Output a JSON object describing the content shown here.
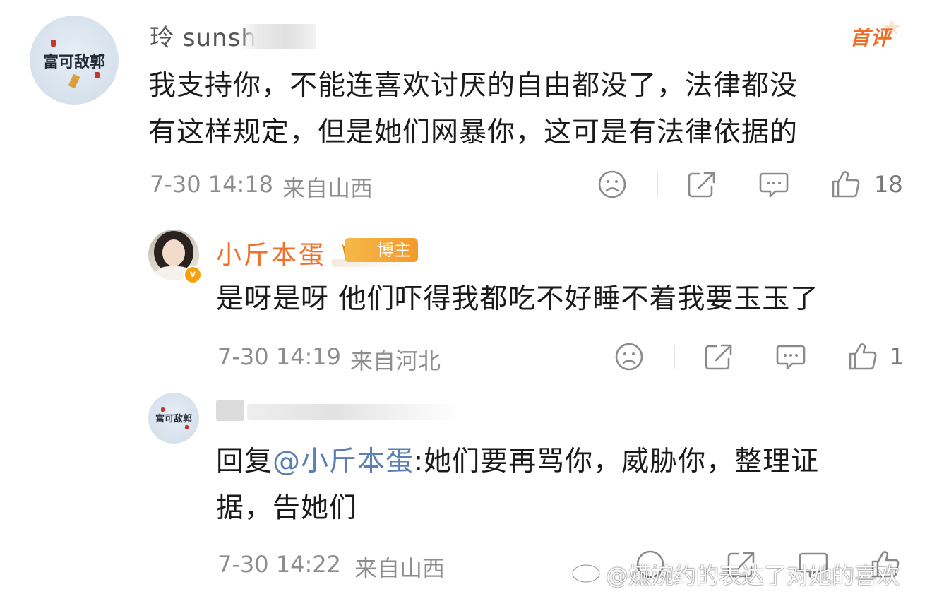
{
  "comments": [
    {
      "username": "玲 sunshine",
      "avatar_text": "富可敌郭",
      "badge": "首评",
      "text_lines": [
        "我支持你，不能连喜欢讨厌的自由都没了，法律都没",
        "有这样规定，但是她们网暴你，这可是有法律依据的"
      ],
      "time": "7-30 14:18",
      "location": "来自山西",
      "likes": "18"
    },
    {
      "username": "小斤本蛋",
      "role_badge": "博主",
      "text_lines": [
        "是呀是呀 他们吓得我都吃不好睡不着我要玉玉了"
      ],
      "time": "7-30 14:19",
      "location": "来自河北",
      "likes": "1"
    },
    {
      "avatar_text": "富可敌郭",
      "reply_prefix": "回复",
      "reply_mention": "@小斤本蛋",
      "reply_line1_rest": ":她们要再骂你，威胁你，整理证",
      "reply_line2": "据，告她们",
      "time": "7-30 14:22",
      "location": "来自山西"
    }
  ],
  "watermark": "@嬿婉约的表达了对她的喜欢",
  "icons": [
    "dislike-icon",
    "share-icon",
    "comment-icon",
    "like-icon"
  ],
  "colors": {
    "accent": "#f0712a",
    "mention": "#5b7fb3",
    "meta": "#8d8d8d"
  }
}
